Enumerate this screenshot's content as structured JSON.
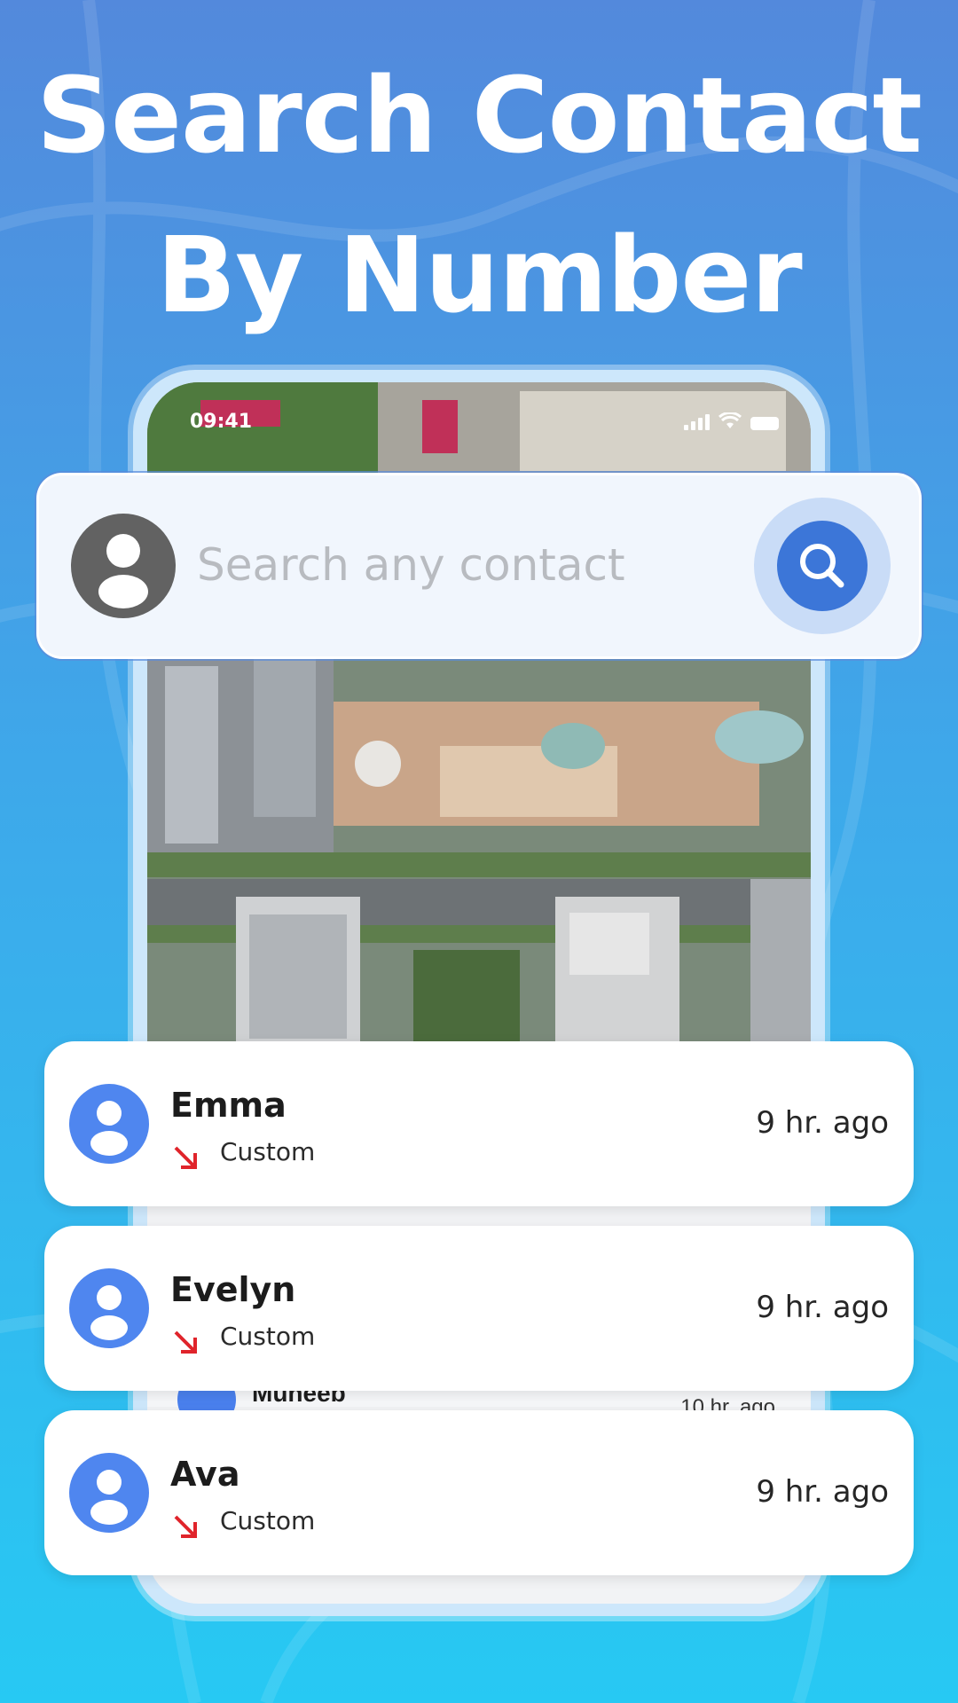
{
  "headline": {
    "line1": "Search Contact",
    "line2": "By Number"
  },
  "status_bar": {
    "time": "09:41"
  },
  "search": {
    "placeholder": "Search any contact"
  },
  "background_contact": {
    "name": "Muneeb",
    "time": "10 hr. ago"
  },
  "contacts": [
    {
      "name": "Emma",
      "type": "Custom",
      "time": "9 hr. ago"
    },
    {
      "name": "Evelyn",
      "type": "Custom",
      "time": "9 hr. ago"
    },
    {
      "name": "Ava",
      "type": "Custom",
      "time": "9 hr. ago"
    }
  ],
  "colors": {
    "accent": "#3c76d8",
    "avatar_blue": "#4f86ef",
    "missed_arrow": "#e0242b",
    "placeholder": "#b8bbc0"
  },
  "icons": {
    "search_button": "search-icon",
    "user_avatar": "person-icon",
    "call_type": "incoming-call-arrow-icon"
  }
}
